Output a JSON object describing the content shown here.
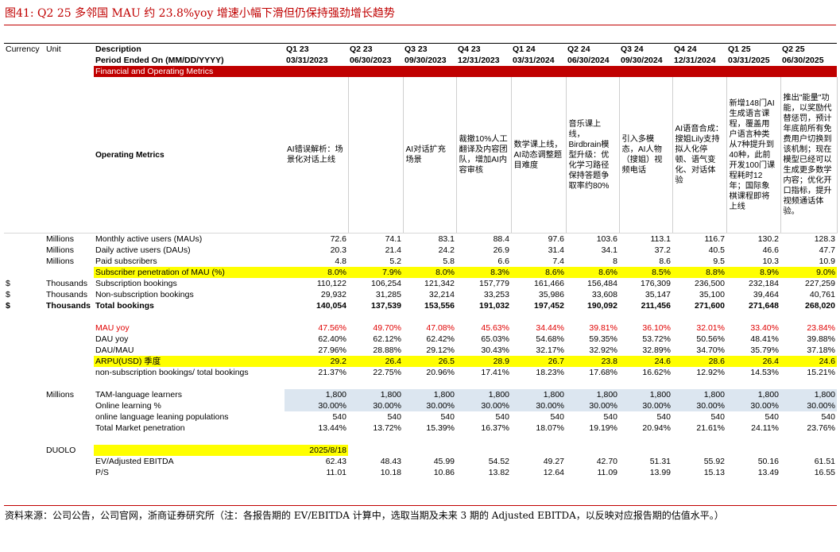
{
  "figure_title": "图41:   Q2 25 多邻国 MAU 约 23.8%yoy 增速小幅下滑但仍保持强劲增长趋势",
  "header": {
    "currency": "Currency",
    "unit": "Unit",
    "description": "Description",
    "period_label": "Period Ended On (MM/DD/YYYY)",
    "quarters": [
      "Q1 23",
      "Q2 23",
      "Q3 23",
      "Q4 23",
      "Q1 24",
      "Q2 24",
      "Q3 24",
      "Q4 24",
      "Q1 25",
      "Q2 25"
    ],
    "dates": [
      "03/31/2023",
      "06/30/2023",
      "09/30/2023",
      "12/31/2023",
      "03/31/2024",
      "06/30/2024",
      "09/30/2024",
      "12/31/2024",
      "03/31/2025",
      "06/30/2025"
    ]
  },
  "section_label": "Financial and Operating Metrics",
  "operating_metrics": {
    "label": "Operating Metrics",
    "notes": [
      "AI错误解析：场景化对话上线",
      "",
      "AI对话扩充场景",
      "裁撤10%人工翻译及内容团队，增加AI内容审核",
      "数学课上线，AI动态调整题目难度",
      "音乐课上线，Birdbrain模型升级：优化学习路径保持答题争取率约80%",
      "引入多模态，AI人物（搜姐）视频电话",
      "AI语音合成：搜姐Lily支持拟人化停顿、语气变化、对话体验",
      "新增148门AI生成语言课程，覆盖用户语言种类从7种提升到40种，此前开发100门课程耗时12年；国际象棋课程即将上线",
      "推出\"能量\"功能，以奖励代替惩罚，预计年底前所有免费用户切换到该机制；现在模型已经可以生成更多数学内容；优化开口指标，提升视频通话体验。"
    ]
  },
  "rows": [
    {
      "currency": "",
      "unit": "Millions",
      "label": "Monthly active users (MAUs)",
      "values": [
        "72.6",
        "74.1",
        "83.1",
        "88.4",
        "97.6",
        "103.6",
        "113.1",
        "116.7",
        "130.2",
        "128.3"
      ]
    },
    {
      "currency": "",
      "unit": "Millions",
      "label": "Daily active users (DAUs)",
      "values": [
        "20.3",
        "21.4",
        "24.2",
        "26.9",
        "31.4",
        "34.1",
        "37.2",
        "40.5",
        "46.6",
        "47.7"
      ]
    },
    {
      "currency": "",
      "unit": "Millions",
      "label": "Paid subscribers",
      "values": [
        "4.8",
        "5.2",
        "5.8",
        "6.6",
        "7.4",
        "8",
        "8.6",
        "9.5",
        "10.3",
        "10.9"
      ]
    },
    {
      "currency": "",
      "unit": "",
      "label": "Subscriber penetration of MAU (%)",
      "values": [
        "8.0%",
        "7.9%",
        "8.0%",
        "8.3%",
        "8.6%",
        "8.6%",
        "8.5%",
        "8.8%",
        "8.9%",
        "9.0%"
      ]
    },
    {
      "currency": "$",
      "unit": "Thousands",
      "label": "Subscription bookings",
      "values": [
        "110,122",
        "106,254",
        "121,342",
        "157,779",
        "161,466",
        "156,484",
        "176,309",
        "236,500",
        "232,184",
        "227,259"
      ]
    },
    {
      "currency": "$",
      "unit": "Thousands",
      "label": "Non-subscription bookings",
      "values": [
        "29,932",
        "31,285",
        "32,214",
        "33,253",
        "35,986",
        "33,608",
        "35,147",
        "35,100",
        "39,464",
        "40,761"
      ]
    },
    {
      "currency": "$",
      "unit": "Thousands",
      "label": "Total bookings",
      "values": [
        "140,054",
        "137,539",
        "153,556",
        "191,032",
        "197,452",
        "190,092",
        "211,456",
        "271,600",
        "271,648",
        "268,020"
      ]
    },
    {
      "currency": "",
      "unit": "",
      "label": "MAU yoy",
      "values": [
        "47.56%",
        "49.70%",
        "47.08%",
        "45.63%",
        "34.44%",
        "39.81%",
        "36.10%",
        "32.01%",
        "33.40%",
        "23.84%"
      ]
    },
    {
      "currency": "",
      "unit": "",
      "label": "DAU yoy",
      "values": [
        "62.40%",
        "62.12%",
        "62.42%",
        "65.03%",
        "54.68%",
        "59.35%",
        "53.72%",
        "50.56%",
        "48.41%",
        "39.88%"
      ]
    },
    {
      "currency": "",
      "unit": "",
      "label": "DAU/MAU",
      "values": [
        "27.96%",
        "28.88%",
        "29.12%",
        "30.43%",
        "32.17%",
        "32.92%",
        "32.89%",
        "34.70%",
        "35.79%",
        "37.18%"
      ]
    },
    {
      "currency": "",
      "unit": "",
      "label": "ARPU(USD) 季度",
      "values": [
        "29.2",
        "26.4",
        "26.5",
        "28.9",
        "26.7",
        "23.8",
        "24.6",
        "28.6",
        "26.4",
        "24.6"
      ]
    },
    {
      "currency": "",
      "unit": "",
      "label": "non-subscription bookings/ total bookings",
      "values": [
        "21.37%",
        "22.75%",
        "20.96%",
        "17.41%",
        "18.23%",
        "17.68%",
        "16.62%",
        "12.92%",
        "14.53%",
        "15.21%"
      ]
    },
    {
      "currency": "",
      "unit": "Millions",
      "label": "TAM-language learners",
      "values": [
        "1,800",
        "1,800",
        "1,800",
        "1,800",
        "1,800",
        "1,800",
        "1,800",
        "1,800",
        "1,800",
        "1,800"
      ]
    },
    {
      "currency": "",
      "unit": "",
      "label": "Online learning %",
      "values": [
        "30.00%",
        "30.00%",
        "30.00%",
        "30.00%",
        "30.00%",
        "30.00%",
        "30.00%",
        "30.00%",
        "30.00%",
        "30.00%"
      ]
    },
    {
      "currency": "",
      "unit": "",
      "label": "online language leaning populations",
      "values": [
        "540",
        "540",
        "540",
        "540",
        "540",
        "540",
        "540",
        "540",
        "540",
        "540"
      ]
    },
    {
      "currency": "",
      "unit": "",
      "label": "Total Market penetration",
      "values": [
        "13.44%",
        "13.72%",
        "15.39%",
        "16.37%",
        "18.07%",
        "19.19%",
        "20.94%",
        "21.61%",
        "24.11%",
        "23.76%"
      ]
    },
    {
      "currency": "",
      "unit": "DUOLO",
      "label": "",
      "date": "2025/8/18"
    },
    {
      "currency": "",
      "unit": "",
      "label": "EV/Adjusted EBITDA",
      "values": [
        "62.43",
        "48.43",
        "45.99",
        "54.52",
        "49.27",
        "42.70",
        "51.31",
        "55.92",
        "50.16",
        "61.51"
      ]
    },
    {
      "currency": "",
      "unit": "",
      "label": "P/S",
      "values": [
        "11.01",
        "10.18",
        "10.86",
        "13.82",
        "12.64",
        "11.09",
        "13.99",
        "15.13",
        "13.49",
        "16.55"
      ]
    }
  ],
  "source_note": "资料来源：公司公告，公司官网，浙商证券研究所（注：各报告期的 EV/EBITDA 计算中，选取当期及未来 3 期的 Adjusted EBITDA，以反映对应报告期的估值水平。）",
  "colors": {
    "accent_red": "#c00000",
    "highlight_yellow": "#ffff00",
    "light_blue": "#dce6f0",
    "red_text": "#e00000"
  }
}
